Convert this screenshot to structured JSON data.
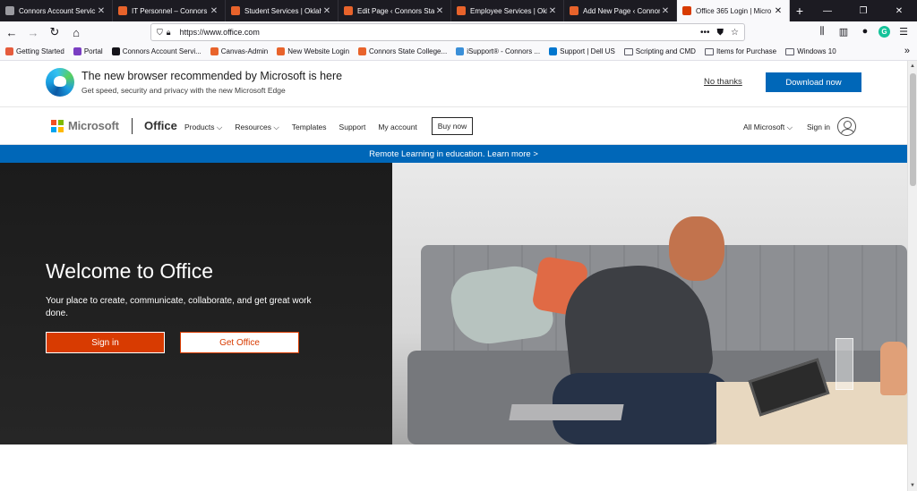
{
  "browser": {
    "tabs": [
      {
        "title": "Connors Account Servic",
        "color": "#9a9aa0",
        "active": false
      },
      {
        "title": "IT Personnel – Connors S",
        "color": "#e8632b",
        "active": false
      },
      {
        "title": "Student Services | Oklah",
        "color": "#e8632b",
        "active": false
      },
      {
        "title": "Edit Page ‹ Connors Stat",
        "color": "#e8632b",
        "active": false
      },
      {
        "title": "Employee Services | Okl",
        "color": "#e8632b",
        "active": false
      },
      {
        "title": "Add New Page ‹ Connors",
        "color": "#e8632b",
        "active": false
      },
      {
        "title": "Office 365 Login | Micro",
        "color": "#d83b01",
        "active": true
      }
    ],
    "new_tab": "+",
    "url": "https://www.office.com",
    "url_menu": "•••",
    "bookmarks": [
      {
        "label": "Getting Started",
        "color": "#e55b3c",
        "folder": false
      },
      {
        "label": "Portal",
        "color": "#7a3ec2",
        "folder": false
      },
      {
        "label": "Connors Account Servi...",
        "color": "#15141a",
        "folder": false
      },
      {
        "label": "Canvas-Admin",
        "color": "#e8632b",
        "folder": false
      },
      {
        "label": "New Website Login",
        "color": "#e8632b",
        "folder": false
      },
      {
        "label": "Connors State College...",
        "color": "#e8632b",
        "folder": false
      },
      {
        "label": "iSupport® - Connors ...",
        "color": "#3a8fd8",
        "folder": false
      },
      {
        "label": "Support | Dell US",
        "color": "#0076ce",
        "folder": false
      },
      {
        "label": "Scripting and CMD",
        "color": "",
        "folder": true
      },
      {
        "label": "Items for Purchase",
        "color": "",
        "folder": true
      },
      {
        "label": "Windows 10",
        "color": "",
        "folder": true
      }
    ],
    "more_bookmarks": "»"
  },
  "edge_banner": {
    "title": "The new browser recommended by Microsoft is here",
    "subtitle": "Get speed, security and privacy with the new Microsoft Edge",
    "no_thanks": "No thanks",
    "download": "Download now"
  },
  "header": {
    "brand": "Microsoft",
    "product": "Office",
    "nav": [
      "Products ⌵",
      "Resources ⌵",
      "Templates",
      "Support",
      "My account"
    ],
    "buy_now": "Buy now",
    "all_microsoft": "All Microsoft ⌵",
    "sign_in": "Sign in",
    "logo_colors": [
      "#f25022",
      "#7fba00",
      "#00a4ef",
      "#ffb900"
    ]
  },
  "announcement": {
    "text": "Remote Learning in education. Learn more >"
  },
  "hero": {
    "title": "Welcome to Office",
    "subtitle": "Your place to create, communicate, collaborate, and get great work done.",
    "sign_in": "Sign in",
    "get_office": "Get Office"
  }
}
